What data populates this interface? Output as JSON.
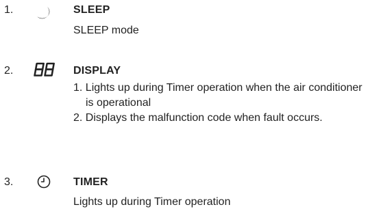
{
  "items": [
    {
      "number": "1.",
      "icon": "moon-icon",
      "title": "SLEEP",
      "description": "SLEEP mode"
    },
    {
      "number": "2.",
      "icon": "seven-segment-88-icon",
      "title": "DISPLAY",
      "details": [
        "1. Lights up during Timer operation when the air conditioner is operational",
        "2. Displays the malfunction code when fault occurs."
      ]
    },
    {
      "number": "3.",
      "icon": "clock-icon",
      "title": "TIMER",
      "description": "Lights up during Timer operation"
    }
  ]
}
